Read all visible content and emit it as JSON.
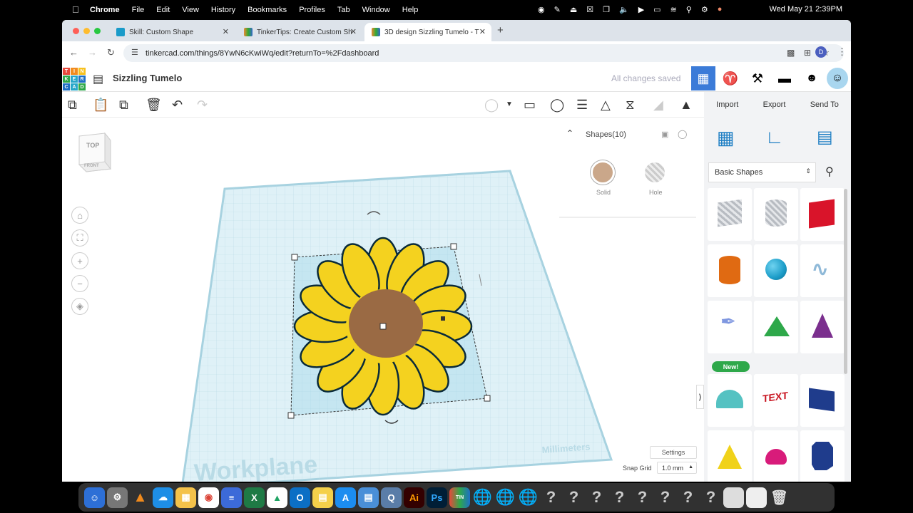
{
  "menubar": {
    "app": "Chrome",
    "items": [
      "File",
      "Edit",
      "View",
      "History",
      "Bookmarks",
      "Profiles",
      "Tab",
      "Window",
      "Help"
    ],
    "clock": "Wed May 21  2:39PM"
  },
  "tabs": [
    {
      "label": "Skill: Custom Shape",
      "active": false
    },
    {
      "label": "TinkerTips: Create Custom Sh",
      "active": false
    },
    {
      "label": "3D design Sizzling Tumelo - T",
      "active": true
    }
  ],
  "url": "tinkercad.com/things/8YwN6cKwiWq/edit?returnTo=%2Fdashboard",
  "profile_initial": "D",
  "tinkercad": {
    "logo_letters": [
      "T",
      "I",
      "N",
      "K",
      "E",
      "R",
      "C",
      "A",
      "D"
    ],
    "design_title": "Sizzling Tumelo",
    "save_status": "All changes saved",
    "import_label": "Import",
    "export_label": "Export",
    "sendto_label": "Send To"
  },
  "viewcube": {
    "top": "TOP",
    "front": "FRONT"
  },
  "shapes_panel": {
    "title": "Shapes(10)",
    "solid_label": "Solid",
    "hole_label": "Hole",
    "solid_color": "#caa78a"
  },
  "workplane": {
    "label": "Workplane",
    "units": "Millimeters",
    "settings_label": "Settings",
    "snap_label": "Snap Grid",
    "snap_value": "1.0 mm"
  },
  "library": {
    "category": "Basic Shapes",
    "new_badge": "New!",
    "shapes": [
      {
        "name": "box-striped",
        "color": "#b8bcc2"
      },
      {
        "name": "cylinder-striped",
        "color": "#b8bcc2"
      },
      {
        "name": "box",
        "color": "#d9142a"
      },
      {
        "name": "cylinder",
        "color": "#e06a12"
      },
      {
        "name": "sphere",
        "color": "#1b9cc8"
      },
      {
        "name": "scribble",
        "color": "#8fb9d8"
      },
      {
        "name": "shape-generator",
        "color": "#7f97e0"
      },
      {
        "name": "roof",
        "color": "#2ea84a"
      },
      {
        "name": "cone",
        "color": "#7b2f8e"
      },
      {
        "name": "round-roof",
        "color": "#55c2c2"
      },
      {
        "name": "text",
        "color": "#c8121e"
      },
      {
        "name": "wedge-box",
        "color": "#1f3c8c"
      },
      {
        "name": "pyramid",
        "color": "#f0d21a"
      },
      {
        "name": "half-sphere",
        "color": "#d81b7a"
      },
      {
        "name": "polygon",
        "color": "#1f3c8c"
      }
    ]
  }
}
